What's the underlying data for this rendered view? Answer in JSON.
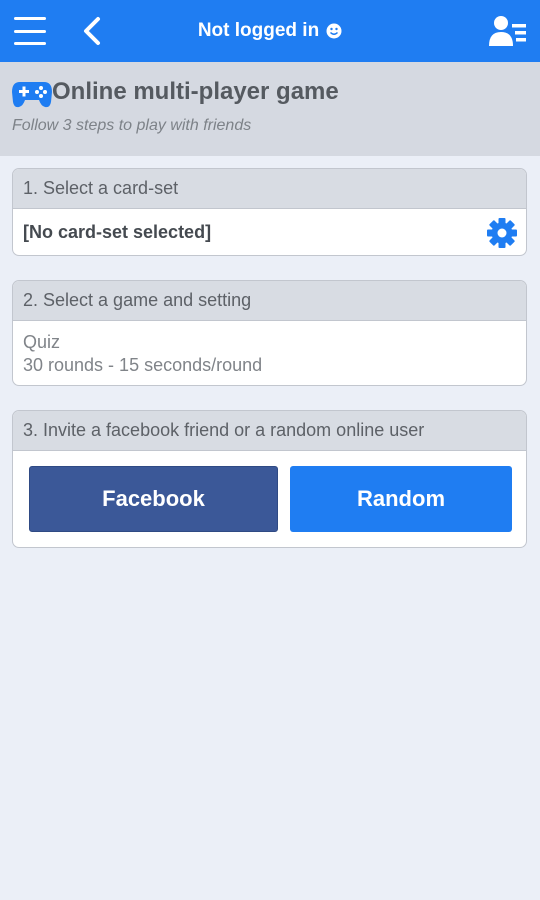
{
  "topbar": {
    "title": "Not logged in",
    "menu_icon": "hamburger-icon",
    "back_icon": "chevron-left-icon",
    "status_icon": "smiley-icon",
    "profile_icon": "user-list-icon",
    "color": "#1f7df2"
  },
  "header": {
    "icon": "gamepad-icon",
    "title": "Online multi-player game",
    "subtitle": "Follow 3 steps to play with friends"
  },
  "step1": {
    "label": "1. Select a card-set",
    "value": "[No card-set selected]",
    "settings_icon": "gear-icon"
  },
  "step2": {
    "label": "2. Select a game and setting",
    "game": "Quiz",
    "setting": "30 rounds - 15 seconds/round"
  },
  "step3": {
    "label": "3. Invite a facebook friend or a random online user",
    "facebook_label": "Facebook",
    "random_label": "Random",
    "facebook_color": "#3b5898",
    "random_color": "#1f7df2"
  }
}
